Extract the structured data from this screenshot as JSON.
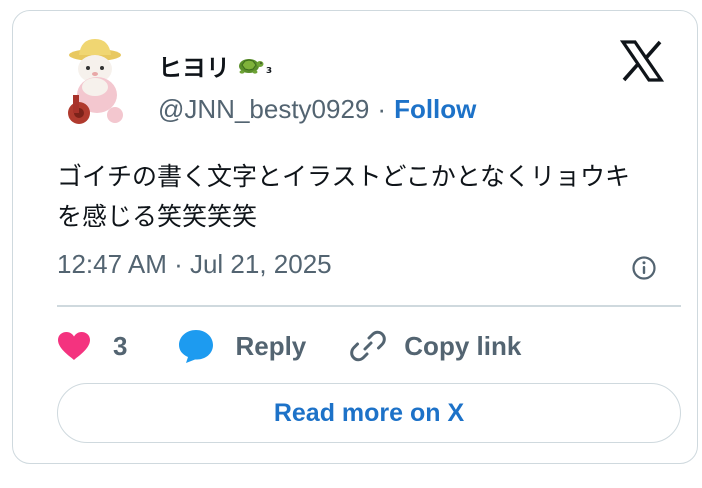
{
  "user": {
    "display_name": "ヒヨリ",
    "name_suffix": "₃",
    "handle": "@JNN_besty0929",
    "separator": "·",
    "follow_label": "Follow",
    "emoji_icon": "turtle-icon"
  },
  "tweet": {
    "text_line1": "ゴイチの書く文字とイラストどこかとなくリョウキ",
    "text_line2": "を感じる笑笑笑笑",
    "timestamp": "12:47 AM · Jul 21, 2025"
  },
  "actions": {
    "like_count": "3",
    "reply_label": "Reply",
    "copy_label": "Copy link"
  },
  "footer": {
    "read_more_label": "Read more on X"
  },
  "colors": {
    "like": "#f4337f",
    "reply": "#1d9bf0",
    "link": "#1d72c8",
    "muted": "#536471",
    "border": "#cfd9de"
  }
}
